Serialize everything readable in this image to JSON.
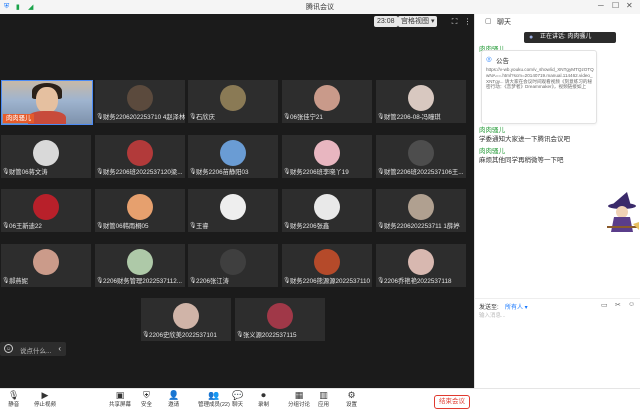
{
  "window": {
    "title": "腾讯会议"
  },
  "topbar": {
    "speaking_label": "正在讲话: 肉肉骚儿",
    "time": "23:08",
    "view_label": "宫格视图 ▾"
  },
  "participants": [
    {
      "name": "肉肉骚儿",
      "avatar_color": "#c4a184"
    },
    {
      "name": "财务2206202253710 4赵泽林",
      "avatar_color": "#5b4a3d"
    },
    {
      "name": "石欣庆",
      "avatar_color": "#8a7a55"
    },
    {
      "name": "06张佳宁21",
      "avatar_color": "#c99a8a"
    },
    {
      "name": "财管2206-08-冯瞳琪",
      "avatar_color": "#d8c8c0"
    },
    {
      "name": "财管06蒋文涛",
      "avatar_color": "#d9d9d9"
    },
    {
      "name": "财务2206班2022537120梁...",
      "avatar_color": "#b23a3a"
    },
    {
      "name": "财务2206苗静阳03",
      "avatar_color": "#6a9cd4"
    },
    {
      "name": "财务2206班李晓丫19",
      "avatar_color": "#e8b6c0"
    },
    {
      "name": "财管2206班2022537106王...",
      "avatar_color": "#4d4d4d"
    },
    {
      "name": "06王新迪22",
      "avatar_color": "#b8202a"
    },
    {
      "name": "财管06韩雨桐05",
      "avatar_color": "#e6a06e"
    },
    {
      "name": "王睿",
      "avatar_color": "#eeeeee"
    },
    {
      "name": "财务2206张鑫",
      "avatar_color": "#e9e9e9"
    },
    {
      "name": "财务2206202253711 1薛婷",
      "avatar_color": "#b0a090"
    },
    {
      "name": "郝燕妮",
      "avatar_color": "#cb9b8a"
    },
    {
      "name": "2206财务管理2022537112...",
      "avatar_color": "#aec9a8"
    },
    {
      "name": "2206张江涛",
      "avatar_color": "#3f3f3f"
    },
    {
      "name": "财务2206熊源源2022537110",
      "avatar_color": "#b54a2a"
    },
    {
      "name": "2206乔艳艳2022537118",
      "avatar_color": "#d8b8b0"
    },
    {
      "name": "2206史欣美2022537101",
      "avatar_color": "#d0b4a8"
    },
    {
      "name": "张义源2022537115",
      "avatar_color": "#a03848"
    }
  ],
  "search_bar": {
    "placeholder": "说点什么..."
  },
  "toolbar": {
    "items": [
      "静音",
      "停止视频",
      "共享屏幕",
      "安全",
      "邀请",
      "管理成员(22)",
      "聊天",
      "录制",
      "分组讨论",
      "应用",
      "设置"
    ],
    "end_label": "结束会议"
  },
  "chat": {
    "title": "聊天",
    "speaking_label": "正在讲话: 肉肉骚儿",
    "notice_title": "公告",
    "notice_body": "https://v-wb.youku.com/v_show/id_XNTgyMTQzOTQwNA==.html?scm=20140719.manual.114462.video_XNTgy... 请大家在会议时间观看视频《刻意练习的秘密行动：《音梦者》Dreammaker》，视频链接如上",
    "messages": [
      {
        "sender": "肉肉骚儿",
        "text": ""
      },
      {
        "sender": "肉肉骚儿",
        "text": "学委通知大家进一下腾讯会议吧"
      },
      {
        "sender": "肉肉骚儿",
        "text": "麻烦其他同学再稍微等一下吧"
      }
    ],
    "send_to_label": "发送至:",
    "send_to_value": "所有人 ▾",
    "input_placeholder": "输入消息..."
  },
  "colors": {
    "active_border": "#4c8bf5",
    "end_red": "#e03a2f",
    "chat_green": "#2a9d3c",
    "link_blue": "#1677ff"
  }
}
